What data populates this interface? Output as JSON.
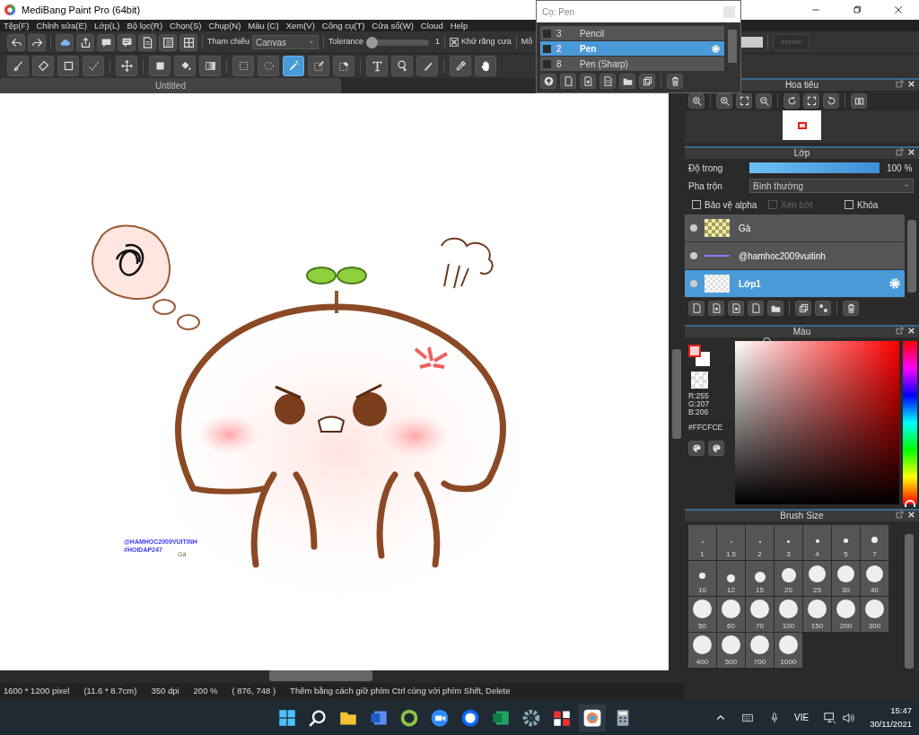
{
  "window": {
    "title": "MediBang Paint Pro (64bit)"
  },
  "menu": [
    "Tệp(F)",
    "Chỉnh sửa(E)",
    "Lớp(L)",
    "Bộ lọc(R)",
    "Chọn(S)",
    "Chụp(N)",
    "Màu (C)",
    "Xem(V)",
    "Công cụ(T)",
    "Cửa sổ(W)",
    "Cloud",
    "Help"
  ],
  "toolbar": {
    "reference_label": "Tham chiếu",
    "reference_value": "Canvas",
    "tolerance_label": "Tolerance",
    "tolerance": {
      "level": 0,
      "reading": "1"
    },
    "antialias": {
      "label": "Khử răng cưa",
      "checked": true
    },
    "cut_label": "Mô",
    "cut_button": "eselec"
  },
  "tools": [
    {
      "selected": false
    },
    {
      "selected": false
    },
    {
      "selected": false
    },
    {
      "selected": false
    },
    {
      "selected": false
    },
    {
      "selected": false
    },
    {
      "selected": false
    },
    {
      "selected": false
    },
    {
      "selected": false
    },
    {
      "selected": false
    },
    {
      "selected": true
    },
    {
      "selected": false
    },
    {
      "selected": false
    },
    {
      "selected": false
    },
    {
      "selected": false
    },
    {
      "selected": false
    },
    {
      "selected": false
    },
    {
      "selected": false
    }
  ],
  "document_tab": "Untitled",
  "canvas": {
    "texts": [
      "@HAMHOC2009VUITINH",
      "#HOIDAP247",
      "Gà"
    ]
  },
  "status_bar": [
    "1600 * 1200 pixel",
    "(11.6 * 8.7cm)",
    "350 dpi",
    "200 %",
    "( 876, 748 )",
    "Thêm bằng cách giữ phím Ctrl cùng với phím Shift, Delete"
  ],
  "brush_popup": {
    "search": "Cọ: Pen",
    "brushes": [
      {
        "number": "3",
        "name": "Pencil",
        "selected": false
      },
      {
        "number": "2",
        "name": "Pen",
        "selected": true
      },
      {
        "number": "8",
        "name": "Pen (Sharp)",
        "selected": false
      }
    ]
  },
  "navigator": {
    "title": "Hoa tiêu"
  },
  "layers_panel": {
    "title": "Lớp",
    "opacity_label": "Độ trong",
    "opacity": {
      "level": 1,
      "reading": "100 %"
    },
    "blend_label": "Pha trộn",
    "blend_value": "Bình thường",
    "options": [
      {
        "label": "Bảo vệ alpha",
        "checked": false,
        "disabled": false
      },
      {
        "label": "Xén bớt",
        "checked": false,
        "disabled": true
      },
      {
        "label": "Khóa",
        "checked": false,
        "disabled": false
      }
    ],
    "layers": [
      {
        "name": "Gà",
        "selected": false
      },
      {
        "name": "@hamhoc2009vuitinh",
        "selected": false
      },
      {
        "name": "Lớp1",
        "selected": true
      }
    ]
  },
  "color_panel": {
    "title": "Màu",
    "rgb": [
      "R:255",
      "G:207",
      "B:206"
    ],
    "hex": "#FFCFCE"
  },
  "brush_size": {
    "title": "Brush Size",
    "sizes": [
      "1",
      "1.5",
      "2",
      "3",
      "4",
      "5",
      "7",
      "10",
      "12",
      "15",
      "20",
      "25",
      "30",
      "40",
      "50",
      "60",
      "70",
      "100",
      "150",
      "200",
      "300",
      "400",
      "500",
      "700",
      "1000"
    ]
  },
  "taskbar": {
    "language": "VIE",
    "time": "15:47",
    "date": "30/11/2021"
  }
}
